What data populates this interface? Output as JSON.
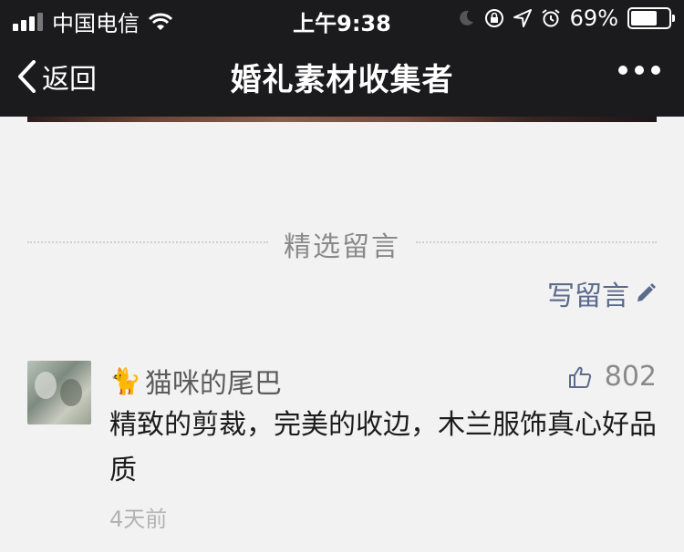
{
  "status_bar": {
    "carrier": "中国电信",
    "time": "上午9:38",
    "battery_percent": "69%",
    "battery_level": 0.69
  },
  "nav": {
    "back_label": "返回",
    "title": "婚礼素材收集者"
  },
  "section": {
    "title": "精选留言",
    "write_label": "写留言"
  },
  "comment": {
    "nickname": "猫咪的尾巴",
    "nickname_emoji": "🐈",
    "likes": "802",
    "text": "精致的剪裁，完美的收边，木兰服饰真心好品质",
    "time": "4天前"
  },
  "colors": {
    "nav_bg": "#1b1b1e",
    "page_bg": "#f2f2f2",
    "link": "#5b6b8c"
  }
}
